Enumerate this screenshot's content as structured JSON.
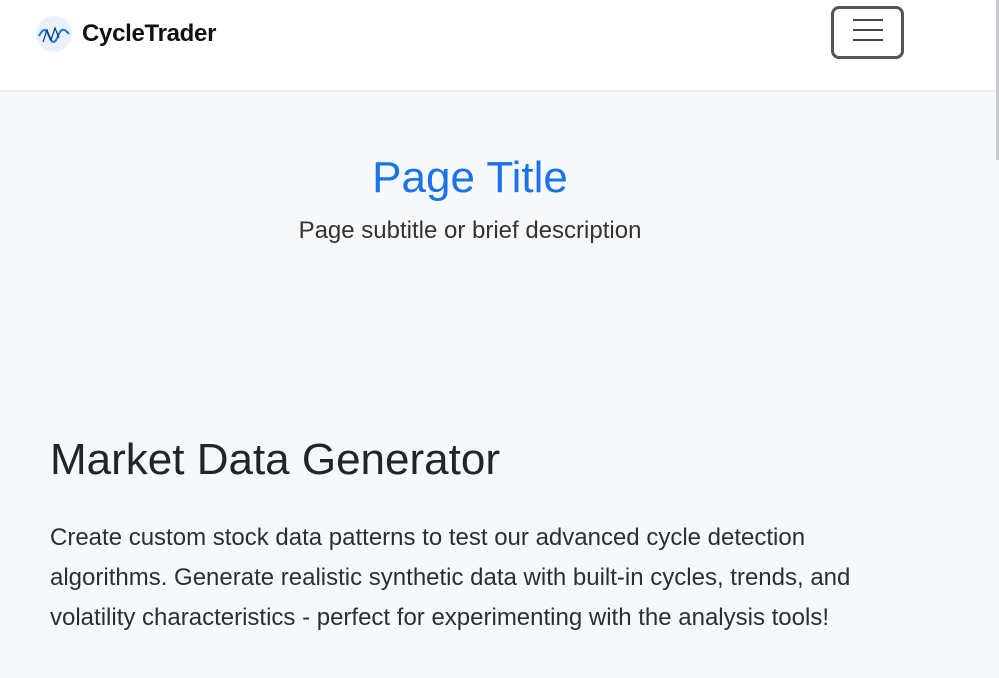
{
  "navbar": {
    "brand_name": "CycleTrader",
    "logo_icon": "wave-cycle-icon",
    "toggler_icon": "hamburger-menu-icon"
  },
  "header": {
    "title": "Page Title",
    "subtitle": "Page subtitle or brief description"
  },
  "section": {
    "title": "Market Data Generator",
    "description": "Create custom stock data patterns to test our advanced cycle detection algorithms. Generate realistic synthetic data with built-in cycles, trends, and volatility characteristics - perfect for experimenting with the analysis tools!"
  },
  "colors": {
    "accent": "#1a73e8",
    "background": "#f7f8fa",
    "navbar": "#ffffff"
  }
}
